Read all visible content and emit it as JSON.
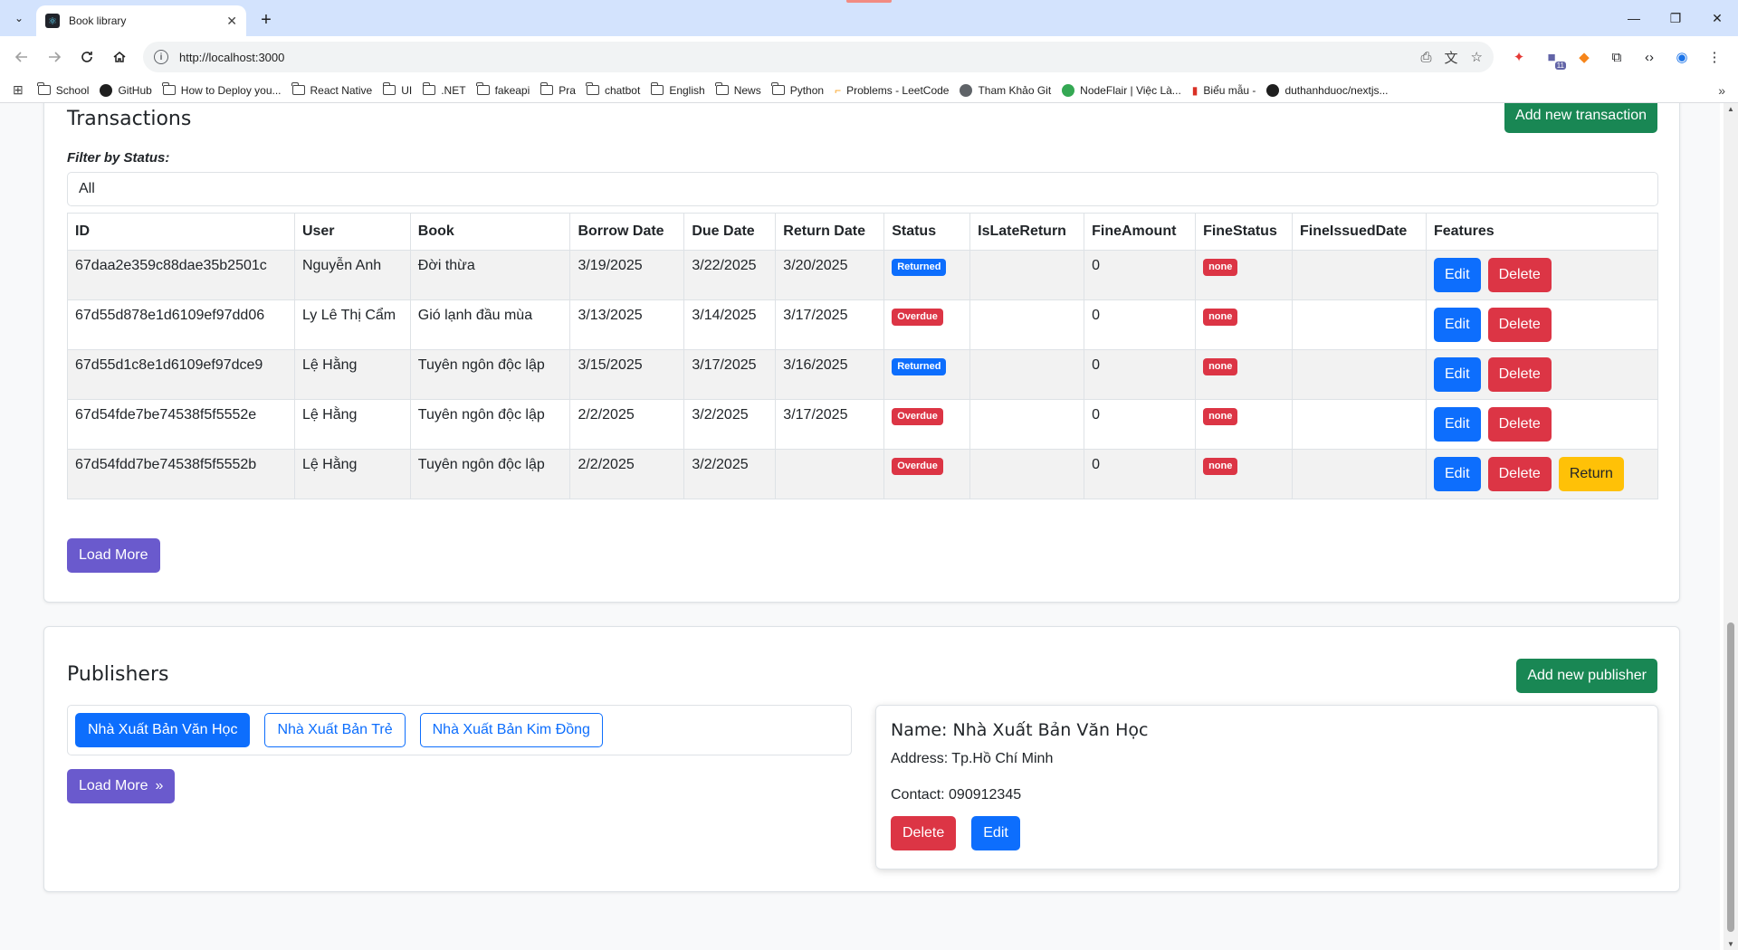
{
  "browser": {
    "tab_title": "Book library",
    "new_tab_symbol": "+",
    "url": "http://localhost:3000",
    "win_minimize": "—",
    "win_restore": "❐",
    "win_close": "✕",
    "ext_badge": "11"
  },
  "bookmarks": [
    {
      "label": "School",
      "icon": "folder"
    },
    {
      "label": "GitHub",
      "icon": "github"
    },
    {
      "label": "How to Deploy you...",
      "icon": "folder"
    },
    {
      "label": "React Native",
      "icon": "folder"
    },
    {
      "label": "UI",
      "icon": "folder"
    },
    {
      "label": ".NET",
      "icon": "folder"
    },
    {
      "label": "fakeapi",
      "icon": "folder"
    },
    {
      "label": "Pra",
      "icon": "folder"
    },
    {
      "label": "chatbot",
      "icon": "folder"
    },
    {
      "label": "English",
      "icon": "folder"
    },
    {
      "label": "News",
      "icon": "folder"
    },
    {
      "label": "Python",
      "icon": "folder"
    },
    {
      "label": "Problems - LeetCode",
      "icon": "leetcode"
    },
    {
      "label": "Tham Khảo Git",
      "icon": "globe"
    },
    {
      "label": "NodeFlair | Việc Là...",
      "icon": "nodeflair"
    },
    {
      "label": "Biểu mẫu -",
      "icon": "form"
    },
    {
      "label": "duthanhduoc/nextjs...",
      "icon": "github"
    }
  ],
  "transactions": {
    "title": "Transactions",
    "add_label": "Add new transaction",
    "filter_label": "Filter by Status:",
    "filter_value": "All",
    "columns": [
      "ID",
      "User",
      "Book",
      "Borrow Date",
      "Due Date",
      "Return Date",
      "Status",
      "IsLateReturn",
      "FineAmount",
      "FineStatus",
      "FineIssuedDate",
      "Features"
    ],
    "rows": [
      {
        "id": "67daa2e359c88dae35b2501c",
        "user": "Nguyễn Anh",
        "book": "Đời thừa",
        "borrow": "3/19/2025",
        "due": "3/22/2025",
        "ret": "3/20/2025",
        "status": "Returned",
        "late": "",
        "fine": "0",
        "fine_status": "none",
        "fine_date": "",
        "return_btn": false
      },
      {
        "id": "67d55d878e1d6109ef97dd06",
        "user": "Ly Lê Thị Cẩm",
        "book": "Gió lạnh đầu mùa",
        "borrow": "3/13/2025",
        "due": "3/14/2025",
        "ret": "3/17/2025",
        "status": "Overdue",
        "late": "",
        "fine": "0",
        "fine_status": "none",
        "fine_date": "",
        "return_btn": false
      },
      {
        "id": "67d55d1c8e1d6109ef97dce9",
        "user": "Lệ Hằng",
        "book": "Tuyên ngôn độc lập",
        "borrow": "3/15/2025",
        "due": "3/17/2025",
        "ret": "3/16/2025",
        "status": "Returned",
        "late": "",
        "fine": "0",
        "fine_status": "none",
        "fine_date": "",
        "return_btn": false
      },
      {
        "id": "67d54fde7be74538f5f5552e",
        "user": "Lệ Hằng",
        "book": "Tuyên ngôn độc lập",
        "borrow": "2/2/2025",
        "due": "3/2/2025",
        "ret": "3/17/2025",
        "status": "Overdue",
        "late": "",
        "fine": "0",
        "fine_status": "none",
        "fine_date": "",
        "return_btn": false
      },
      {
        "id": "67d54fdd7be74538f5f5552b",
        "user": "Lệ Hằng",
        "book": "Tuyên ngôn độc lập",
        "borrow": "2/2/2025",
        "due": "3/2/2025",
        "ret": "",
        "status": "Overdue",
        "late": "",
        "fine": "0",
        "fine_status": "none",
        "fine_date": "",
        "return_btn": true
      }
    ],
    "edit_label": "Edit",
    "delete_label": "Delete",
    "return_label": "Return",
    "load_more_label": "Load More"
  },
  "publishers": {
    "title": "Publishers",
    "add_label": "Add new publisher",
    "items": [
      "Nhà Xuất Bản Văn Học",
      "Nhà Xuất Bản Trẻ",
      "Nhà Xuất Bản Kim Đồng"
    ],
    "load_more_label": "Load More",
    "load_more_icon": "»",
    "detail": {
      "name": "Name: Nhà Xuất Bản Văn Học",
      "address": "Address: Tp.Hồ Chí Minh",
      "contact": "Contact: 090912345",
      "delete_label": "Delete",
      "edit_label": "Edit"
    }
  },
  "colors": {
    "primary": "#0d6efd",
    "success": "#198754",
    "danger": "#dc3545",
    "warning": "#ffc107",
    "load_more": "#6a5acd"
  }
}
